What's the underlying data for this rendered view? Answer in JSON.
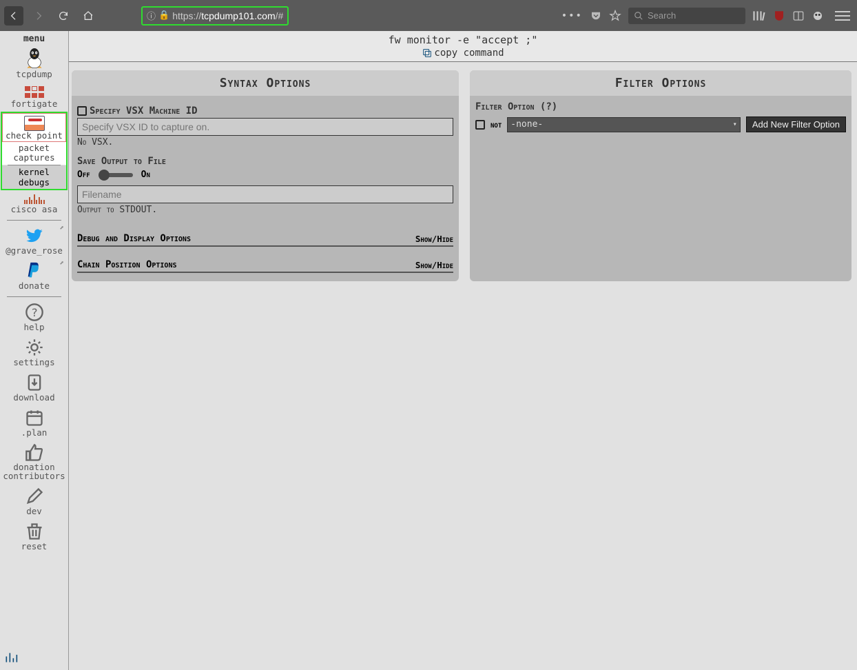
{
  "browser": {
    "url_prefix": "https://",
    "url_host": "tcpdump101.com",
    "url_path": "/#",
    "search_placeholder": "Search"
  },
  "sidebar": {
    "title": "menu",
    "items": [
      {
        "label": "tcpdump"
      },
      {
        "label": "fortigate"
      },
      {
        "label": "check point"
      },
      {
        "label": "cisco asa"
      },
      {
        "label": "@grave_rose"
      },
      {
        "label": "donate"
      },
      {
        "label": "help"
      },
      {
        "label": "settings"
      },
      {
        "label": "download"
      },
      {
        "label": ".plan"
      },
      {
        "label": "donation contributors"
      },
      {
        "label": "dev"
      },
      {
        "label": "reset"
      }
    ],
    "checkpoint_sub": {
      "active": "packet captures",
      "muted": "kernel debugs"
    }
  },
  "banner": {
    "command": "fw monitor -e \"accept ;\"",
    "copy_label": "copy command"
  },
  "syntax_panel": {
    "title": "Syntax Options",
    "vsx_label": "Specify VSX Machine ID",
    "vsx_placeholder": "Specify VSX ID to capture on.",
    "vsx_hint": "No VSX.",
    "save_label": "Save Output to File",
    "off": "Off",
    "on": "On",
    "file_placeholder": "Filename",
    "file_hint": "Output to STDOUT.",
    "debug_section": "Debug and Display Options",
    "chain_section": "Chain Position Options",
    "showhide": "Show/Hide"
  },
  "filter_panel": {
    "title": "Filter Options",
    "option_label": "Filter Option (?)",
    "not_label": "not",
    "select_value": "-none-",
    "add_button": "Add New Filter Option"
  }
}
